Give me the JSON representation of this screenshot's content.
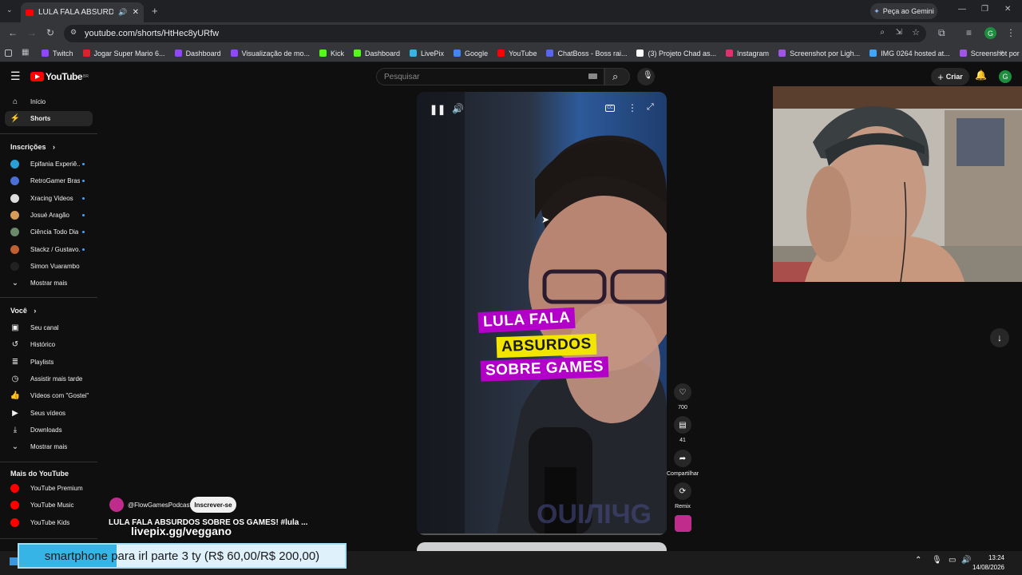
{
  "browser": {
    "tab_title": "LULA FALA ABSURDOS SOB",
    "gemini_label": "Peça ao Gemini",
    "url": "youtube.com/shorts/HtHec8yURfw",
    "profile_initial": "G",
    "bookmarks": [
      {
        "label": "Twitch",
        "color": "#9146ff"
      },
      {
        "label": "Jogar Super Mario 6...",
        "color": "#e0202a"
      },
      {
        "label": "Dashboard",
        "color": "#9146ff"
      },
      {
        "label": "Visualização de mo...",
        "color": "#9146ff"
      },
      {
        "label": "Kick",
        "color": "#53fc18"
      },
      {
        "label": "Dashboard",
        "color": "#53fc18"
      },
      {
        "label": "LivePix",
        "color": "#36b4e6"
      },
      {
        "label": "Google",
        "color": "#4285f4"
      },
      {
        "label": "YouTube",
        "color": "#ff0000"
      },
      {
        "label": "ChatBoss - Boss rai...",
        "color": "#5865f2"
      },
      {
        "label": "(3) Projeto Chad as...",
        "color": "#ffffff"
      },
      {
        "label": "Instagram",
        "color": "#e1306c"
      },
      {
        "label": "Screenshot por Ligh...",
        "color": "#a155e8"
      },
      {
        "label": "IMG 0264 hosted at...",
        "color": "#3ea6ff"
      },
      {
        "label": "Screenshot por Ligh...",
        "color": "#a155e8"
      }
    ]
  },
  "youtube": {
    "logo": "YouTube",
    "logo_sup": "BR",
    "search_placeholder": "Pesquisar",
    "create_label": "Criar",
    "avatar_initial": "G",
    "accent": "#ff0000"
  },
  "sidebar": {
    "home": "Início",
    "shorts": "Shorts",
    "subs_heading": "Inscrições",
    "subs": [
      {
        "label": "Epifania Experiê...",
        "color": "#2a9fd6"
      },
      {
        "label": "RetroGamer Brasil",
        "color": "#4a6fd6"
      },
      {
        "label": "Xracing Videos",
        "color": "#dddddd"
      },
      {
        "label": "Josué Aragão",
        "color": "#d69a5a"
      },
      {
        "label": "Ciência Todo Dia",
        "color": "#6a8a6a"
      },
      {
        "label": "Stackz / Gustavo...",
        "color": "#c06030"
      },
      {
        "label": "Simon Vuarambon",
        "color": "#222222"
      }
    ],
    "show_more": "Mostrar mais",
    "you_heading": "Você",
    "you_items": [
      "Seu canal",
      "Histórico",
      "Playlists",
      "Assistir mais tarde",
      "Vídeos com \"Gostei\"",
      "Seus vídeos",
      "Downloads",
      "Mostrar mais"
    ],
    "more_heading": "Mais do YouTube",
    "more_items": [
      "YouTube Premium",
      "YouTube Music",
      "YouTube Kids"
    ]
  },
  "short": {
    "caption_line1": "LULA FALA",
    "caption_line2": "ABSURDOS",
    "caption_line3": "SOBRE GAMES",
    "likes": "700",
    "comments": "41",
    "share": "Compartilhar",
    "remix": "Remix",
    "channel": "@FlowGamesPodcast",
    "subscribe": "Inscrever-se",
    "title": "LULA FALA ABSURDOS SOBRE OS GAMES! #lula ..."
  },
  "overlay": {
    "livepix": "livepix.gg/veggano",
    "goal_text": "smartphone para irl parte 3 ty (R$ 60,00/R$ 200,00)",
    "goal_progress": 0.3
  },
  "taskbar": {
    "time": "13:24",
    "date": "14/08/2026"
  }
}
